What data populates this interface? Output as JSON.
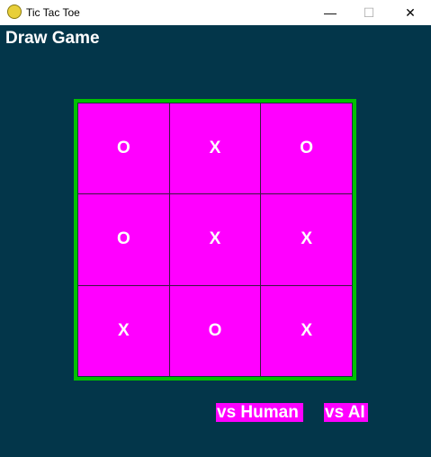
{
  "window": {
    "title": "Tic Tac Toe",
    "minimize": "—",
    "maximize": "☐",
    "close": "✕"
  },
  "status": "Draw Game",
  "board": [
    [
      "O",
      "X",
      "O"
    ],
    [
      "O",
      "X",
      "X"
    ],
    [
      "X",
      "O",
      "X"
    ]
  ],
  "buttons": {
    "vs_human": "vs Human",
    "vs_ai": "vs AI"
  },
  "colors": {
    "background": "#03364a",
    "cell": "#ff00ff",
    "border": "#00c000"
  }
}
